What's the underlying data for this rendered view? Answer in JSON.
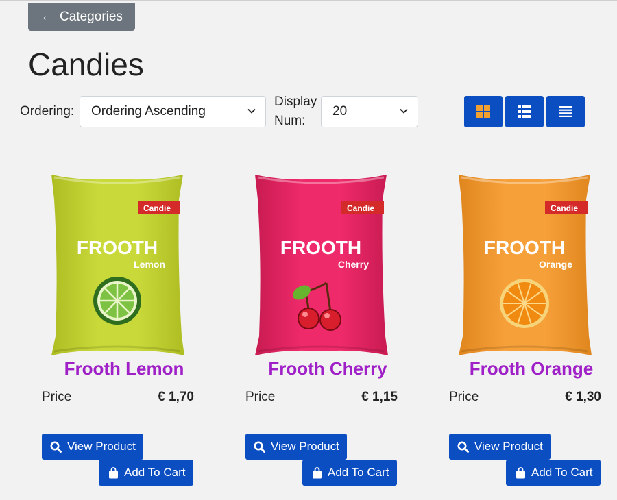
{
  "nav": {
    "back_label": "Categories"
  },
  "page": {
    "title": "Candies"
  },
  "controls": {
    "ordering_label": "Ordering:",
    "ordering_value": "Ordering Ascending",
    "display_label": "Display Num:",
    "display_value": "20"
  },
  "view_buttons": [
    "grid-view-icon",
    "list-view-icon",
    "compact-list-view-icon"
  ],
  "products": [
    {
      "name": "Frooth Lemon",
      "price_label": "Price",
      "price": "€ 1,70",
      "bag_brand": "FROOTH",
      "bag_flavor": "Lemon",
      "bag_tag": "Candie",
      "view_label": "View Product",
      "cart_label": "Add To Cart",
      "colors": {
        "bag": "#c9d93a",
        "bag_dark": "#aebd22",
        "accent": "#2f8f2a"
      }
    },
    {
      "name": "Frooth Cherry",
      "price_label": "Price",
      "price": "€ 1,15",
      "bag_brand": "FROOTH",
      "bag_flavor": "Cherry",
      "bag_tag": "Candie",
      "view_label": "View Product",
      "cart_label": "Add To Cart",
      "colors": {
        "bag": "#ee2a6a",
        "bag_dark": "#c91b52",
        "accent": "#d81e2c"
      }
    },
    {
      "name": "Frooth Orange",
      "price_label": "Price",
      "price": "€ 1,30",
      "bag_brand": "FROOTH",
      "bag_flavor": "Orange",
      "bag_tag": "Candie",
      "view_label": "View Product",
      "cart_label": "Add To Cart",
      "colors": {
        "bag": "#f6a03a",
        "bag_dark": "#e0861e",
        "accent": "#f08a10"
      }
    }
  ],
  "colors": {
    "primary": "#0b4ec2",
    "secondary": "#6c757d",
    "product_name": "#a020c8",
    "background": "#f2f2f2"
  }
}
